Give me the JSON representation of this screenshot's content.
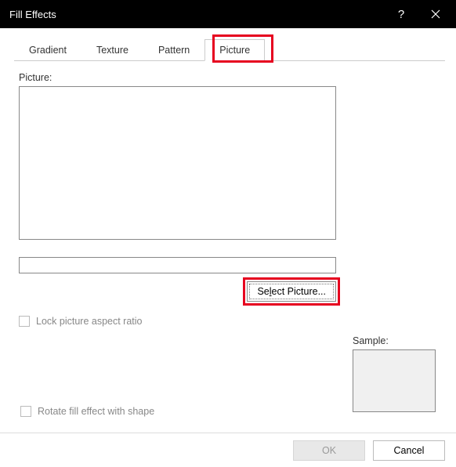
{
  "title": "Fill Effects",
  "tabs": {
    "gradient": "Gradient",
    "texture": "Texture",
    "pattern": "Pattern",
    "picture": "Picture"
  },
  "panel": {
    "picture_label": "Picture:",
    "select_picture": "Se",
    "select_picture_u": "l",
    "select_picture_rest": "ect Picture...",
    "lock_ratio": "Lock picture aspect ratio",
    "sample_label": "Sample:",
    "rotate_label": "Rotate fill effect with shape"
  },
  "footer": {
    "ok": "OK",
    "cancel": "Cancel"
  }
}
